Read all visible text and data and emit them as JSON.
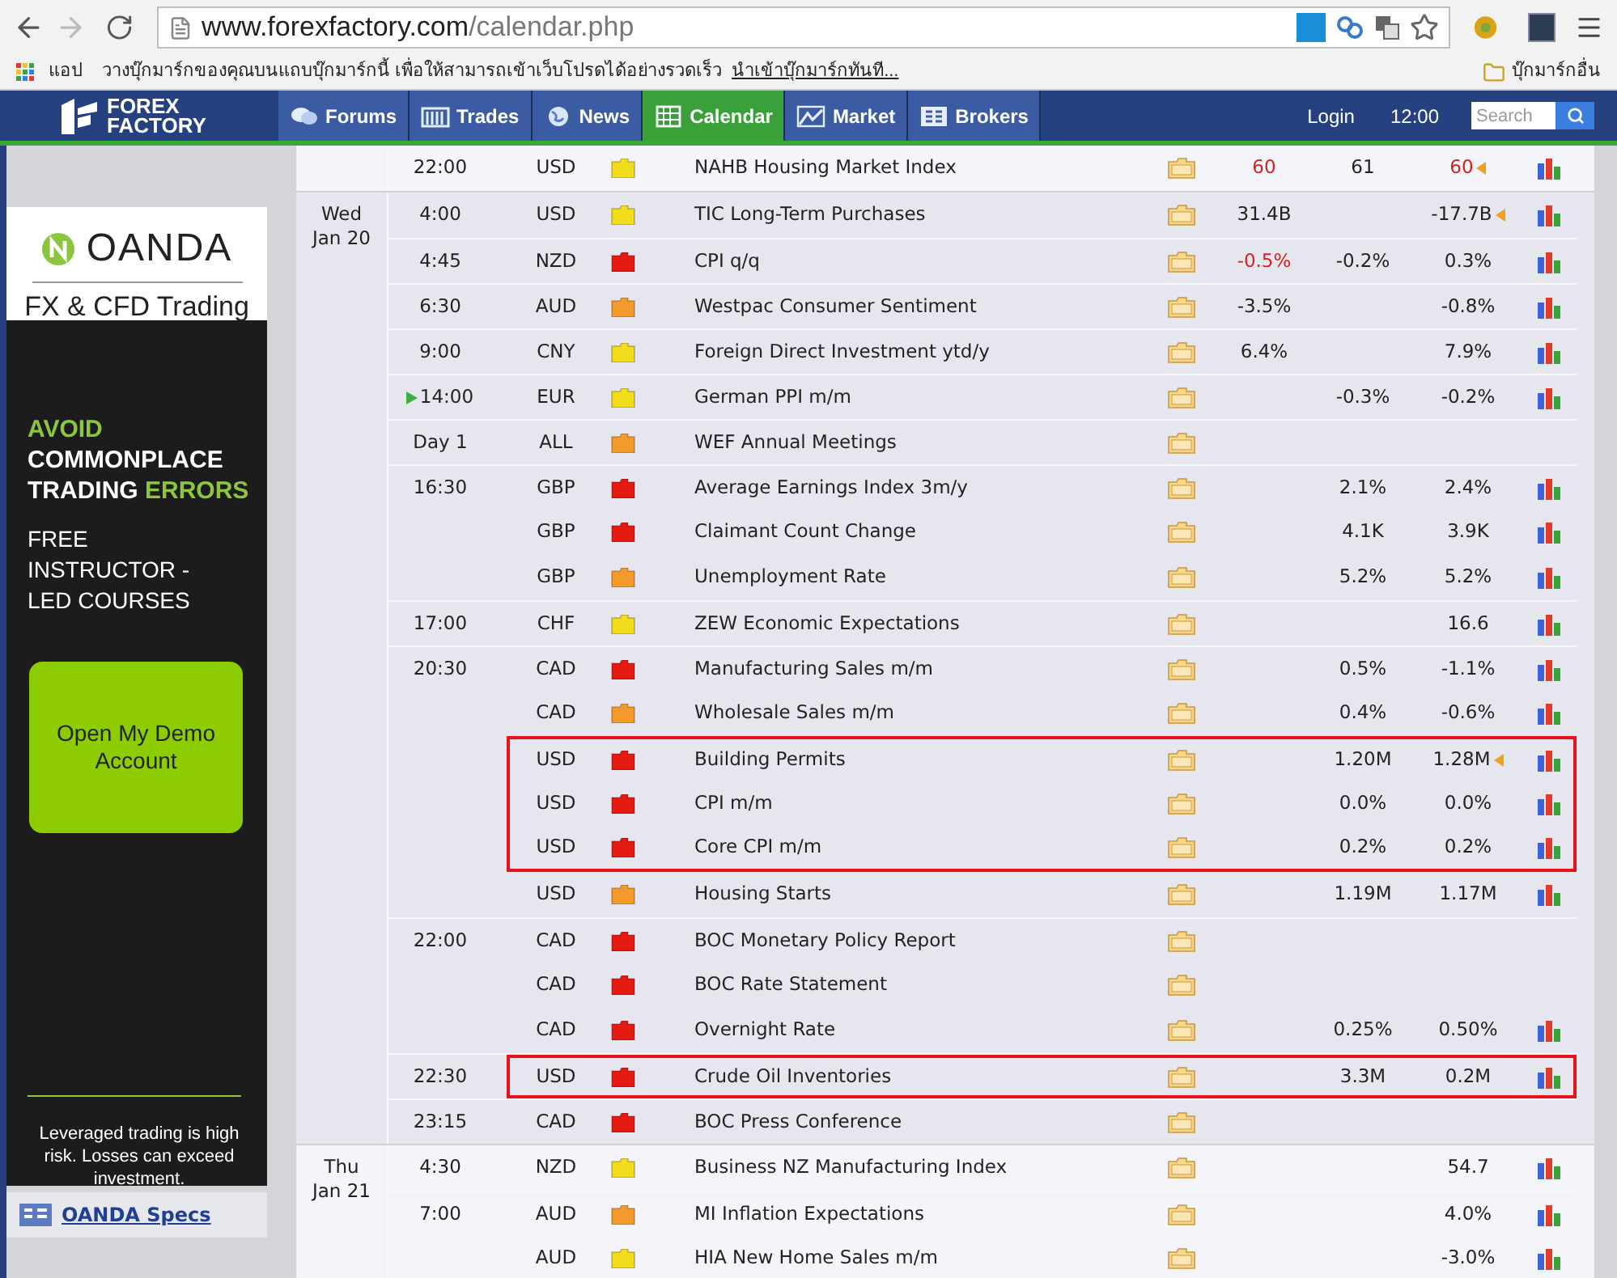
{
  "browser": {
    "url_domain": "www.forexfactory.com",
    "url_path": "/calendar.php",
    "bookmarks_bar": {
      "apps_label": "แอป",
      "hint": "วางบุ๊กมาร์กของคุณบนแถบบุ๊กมาร์กนี้ เพื่อให้สามารถเข้าเว็บโปรดได้อย่างรวดเร็ว",
      "import_link": "นำเข้าบุ๊กมาร์กทันที...",
      "other_folder": "บุ๊กมาร์กอื่น"
    }
  },
  "site_nav": {
    "logo_lines": [
      "FOREX",
      "FACTORY"
    ],
    "items": [
      {
        "label": "Forums",
        "selected": false
      },
      {
        "label": "Trades",
        "selected": false
      },
      {
        "label": "News",
        "selected": false
      },
      {
        "label": "Calendar",
        "selected": true
      },
      {
        "label": "Market",
        "selected": false
      },
      {
        "label": "Brokers",
        "selected": false
      }
    ],
    "login": "Login",
    "time": "12:00",
    "search": {
      "placeholder": "Search"
    }
  },
  "ad": {
    "brand": "OANDA",
    "tagline": "FX & CFD Trading",
    "headline": [
      [
        {
          "text": "AVOID",
          "accent": true
        }
      ],
      [
        {
          "text": "COMMONPLACE",
          "accent": false
        }
      ],
      [
        {
          "text": "TRADING ",
          "accent": false
        },
        {
          "text": "ERRORS",
          "accent": true
        }
      ]
    ],
    "subline": "FREE INSTRUCTOR - LED COURSES",
    "button": "Open My Demo Account",
    "disclaimer": "Leveraged trading is high risk. Losses can exceed investment.",
    "specs_link": "OANDA Specs"
  },
  "calendar": {
    "days": [
      {
        "rows": [
          {
            "time": "22:00",
            "currency": "USD",
            "color": "#f2dd1c",
            "event": "NAHB Housing Market Index",
            "actual": "60",
            "forecast": "61",
            "previous": "60",
            "actual_worse": true,
            "previous_worse": true,
            "previous_revised": true,
            "graph": true,
            "upcoming": false,
            "highlighted": false
          }
        ]
      },
      {
        "date": [
          "Wed",
          "Jan 20"
        ],
        "rows": [
          {
            "time": "4:00",
            "currency": "USD",
            "color": "#f2dd1c",
            "event": "TIC Long-Term Purchases",
            "actual": "31.4B",
            "previous": "-17.7B",
            "actual_worse": false,
            "previous_worse": false,
            "previous_revised": true,
            "graph": true,
            "upcoming": false,
            "highlighted": false
          },
          {
            "time": "4:45",
            "currency": "NZD",
            "color": "#e31b12",
            "event": "CPI q/q",
            "actual": "-0.5%",
            "forecast": "-0.2%",
            "previous": "0.3%",
            "actual_worse": true,
            "previous_worse": false,
            "previous_revised": false,
            "graph": true,
            "upcoming": false,
            "highlighted": false
          },
          {
            "time": "6:30",
            "currency": "AUD",
            "color": "#f39a2c",
            "event": "Westpac Consumer Sentiment",
            "actual": "-3.5%",
            "previous": "-0.8%",
            "actual_worse": false,
            "previous_worse": false,
            "previous_revised": false,
            "graph": true,
            "upcoming": false,
            "highlighted": false
          },
          {
            "time": "9:00",
            "currency": "CNY",
            "color": "#f2dd1c",
            "event": "Foreign Direct Investment ytd/y",
            "actual": "6.4%",
            "previous": "7.9%",
            "actual_worse": false,
            "previous_worse": false,
            "previous_revised": false,
            "graph": true,
            "upcoming": false,
            "highlighted": false
          },
          {
            "time": "14:00",
            "currency": "EUR",
            "color": "#f2dd1c",
            "event": "German PPI m/m",
            "forecast": "-0.3%",
            "previous": "-0.2%",
            "previous_worse": false,
            "previous_revised": false,
            "graph": true,
            "upcoming": true,
            "highlighted": false
          },
          {
            "time": "Day 1",
            "currency": "ALL",
            "color": "#f39a2c",
            "event": "WEF Annual Meetings",
            "graph": false,
            "upcoming": false,
            "highlighted": false
          },
          {
            "time": "16:30",
            "currency": "GBP",
            "color": "#e31b12",
            "event": "Average Earnings Index 3m/y",
            "forecast": "2.1%",
            "previous": "2.4%",
            "previous_worse": false,
            "previous_revised": false,
            "graph": true,
            "upcoming": false,
            "highlighted": false
          },
          {
            "currency": "GBP",
            "color": "#e31b12",
            "event": "Claimant Count Change",
            "forecast": "4.1K",
            "previous": "3.9K",
            "previous_worse": false,
            "previous_revised": false,
            "graph": true,
            "upcoming": false,
            "highlighted": false
          },
          {
            "currency": "GBP",
            "color": "#f39a2c",
            "event": "Unemployment Rate",
            "forecast": "5.2%",
            "previous": "5.2%",
            "previous_worse": false,
            "previous_revised": false,
            "graph": true,
            "upcoming": false,
            "highlighted": false
          },
          {
            "time": "17:00",
            "currency": "CHF",
            "color": "#f2dd1c",
            "event": "ZEW Economic Expectations",
            "previous": "16.6",
            "previous_worse": false,
            "previous_revised": false,
            "graph": true,
            "upcoming": false,
            "highlighted": false
          },
          {
            "time": "20:30",
            "currency": "CAD",
            "color": "#e31b12",
            "event": "Manufacturing Sales m/m",
            "forecast": "0.5%",
            "previous": "-1.1%",
            "previous_worse": false,
            "previous_revised": false,
            "graph": true,
            "upcoming": false,
            "highlighted": false
          },
          {
            "currency": "CAD",
            "color": "#f39a2c",
            "event": "Wholesale Sales m/m",
            "forecast": "0.4%",
            "previous": "-0.6%",
            "previous_worse": false,
            "previous_revised": false,
            "graph": true,
            "upcoming": false,
            "highlighted": false
          },
          {
            "currency": "USD",
            "color": "#e31b12",
            "event": "Building Permits",
            "forecast": "1.20M",
            "previous": "1.28M",
            "previous_worse": false,
            "previous_revised": true,
            "graph": true,
            "upcoming": false,
            "highlighted": true
          },
          {
            "currency": "USD",
            "color": "#e31b12",
            "event": "CPI m/m",
            "forecast": "0.0%",
            "previous": "0.0%",
            "previous_worse": false,
            "previous_revised": false,
            "graph": true,
            "upcoming": false,
            "highlighted": true
          },
          {
            "currency": "USD",
            "color": "#e31b12",
            "event": "Core CPI m/m",
            "forecast": "0.2%",
            "previous": "0.2%",
            "previous_worse": false,
            "previous_revised": false,
            "graph": true,
            "upcoming": false,
            "highlighted": true
          },
          {
            "currency": "USD",
            "color": "#f39a2c",
            "event": "Housing Starts",
            "forecast": "1.19M",
            "previous": "1.17M",
            "previous_worse": false,
            "previous_revised": false,
            "graph": true,
            "upcoming": false,
            "highlighted": false
          },
          {
            "time": "22:00",
            "currency": "CAD",
            "color": "#e31b12",
            "event": "BOC Monetary Policy Report",
            "graph": false,
            "upcoming": false,
            "highlighted": false
          },
          {
            "currency": "CAD",
            "color": "#e31b12",
            "event": "BOC Rate Statement",
            "graph": false,
            "upcoming": false,
            "highlighted": false
          },
          {
            "currency": "CAD",
            "color": "#e31b12",
            "event": "Overnight Rate",
            "forecast": "0.25%",
            "previous": "0.50%",
            "previous_worse": false,
            "previous_revised": false,
            "graph": true,
            "upcoming": false,
            "highlighted": false
          },
          {
            "time": "22:30",
            "currency": "USD",
            "color": "#e31b12",
            "event": "Crude Oil Inventories",
            "forecast": "3.3M",
            "previous": "0.2M",
            "previous_worse": false,
            "previous_revised": false,
            "graph": true,
            "upcoming": false,
            "highlighted": true
          },
          {
            "time": "23:15",
            "currency": "CAD",
            "color": "#e31b12",
            "event": "BOC Press Conference",
            "graph": false,
            "upcoming": false,
            "highlighted": false
          }
        ]
      },
      {
        "date": [
          "Thu",
          "Jan 21"
        ],
        "rows": [
          {
            "time": "4:30",
            "currency": "NZD",
            "color": "#f2dd1c",
            "event": "Business NZ Manufacturing Index",
            "previous": "54.7",
            "previous_worse": false,
            "previous_revised": false,
            "graph": true,
            "upcoming": false,
            "highlighted": false
          },
          {
            "time": "7:00",
            "currency": "AUD",
            "color": "#f39a2c",
            "event": "MI Inflation Expectations",
            "previous": "4.0%",
            "previous_worse": false,
            "previous_revised": false,
            "graph": true,
            "upcoming": false,
            "highlighted": false
          },
          {
            "currency": "AUD",
            "color": "#f2dd1c",
            "event": "HIA New Home Sales m/m",
            "previous": "-3.0%",
            "previous_worse": false,
            "previous_revised": false,
            "graph": true,
            "upcoming": false,
            "highlighted": false
          }
        ]
      }
    ]
  }
}
